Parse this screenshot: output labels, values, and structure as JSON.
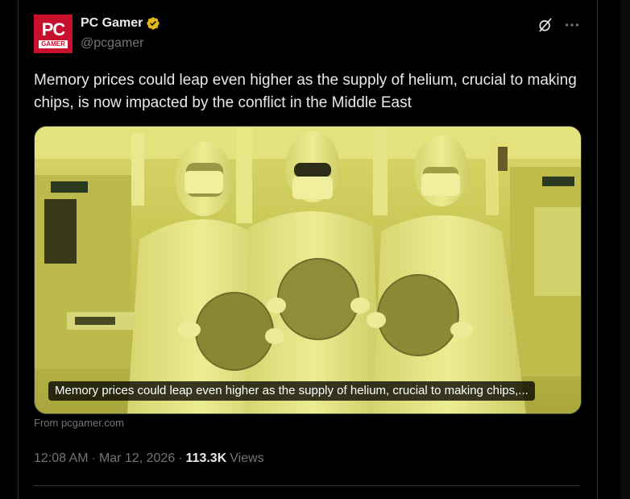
{
  "author": {
    "display_name": "PC Gamer",
    "handle": "@pcgamer",
    "avatar_text_top": "PC",
    "avatar_text_bottom": "GAMER",
    "verified_color": "#e2b719",
    "avatar_color": "#c8102e"
  },
  "actions": {
    "grok_icon": "grok-icon",
    "more_icon": "more-horizontal-icon"
  },
  "tweet": {
    "text": "Memory prices could leap even higher as the supply of helium, crucial to making chips, is now impacted by the conflict in the Middle East"
  },
  "card": {
    "caption": "Memory prices could leap even higher as the supply of helium, crucial to making chips,...",
    "source": "From pcgamer.com",
    "tint_color": "#c8c752"
  },
  "meta": {
    "time": "12:08 AM",
    "sep1": "·",
    "date": "Mar 12, 2026",
    "sep2": "·",
    "views_count": "113.3K",
    "views_label": "Views"
  }
}
